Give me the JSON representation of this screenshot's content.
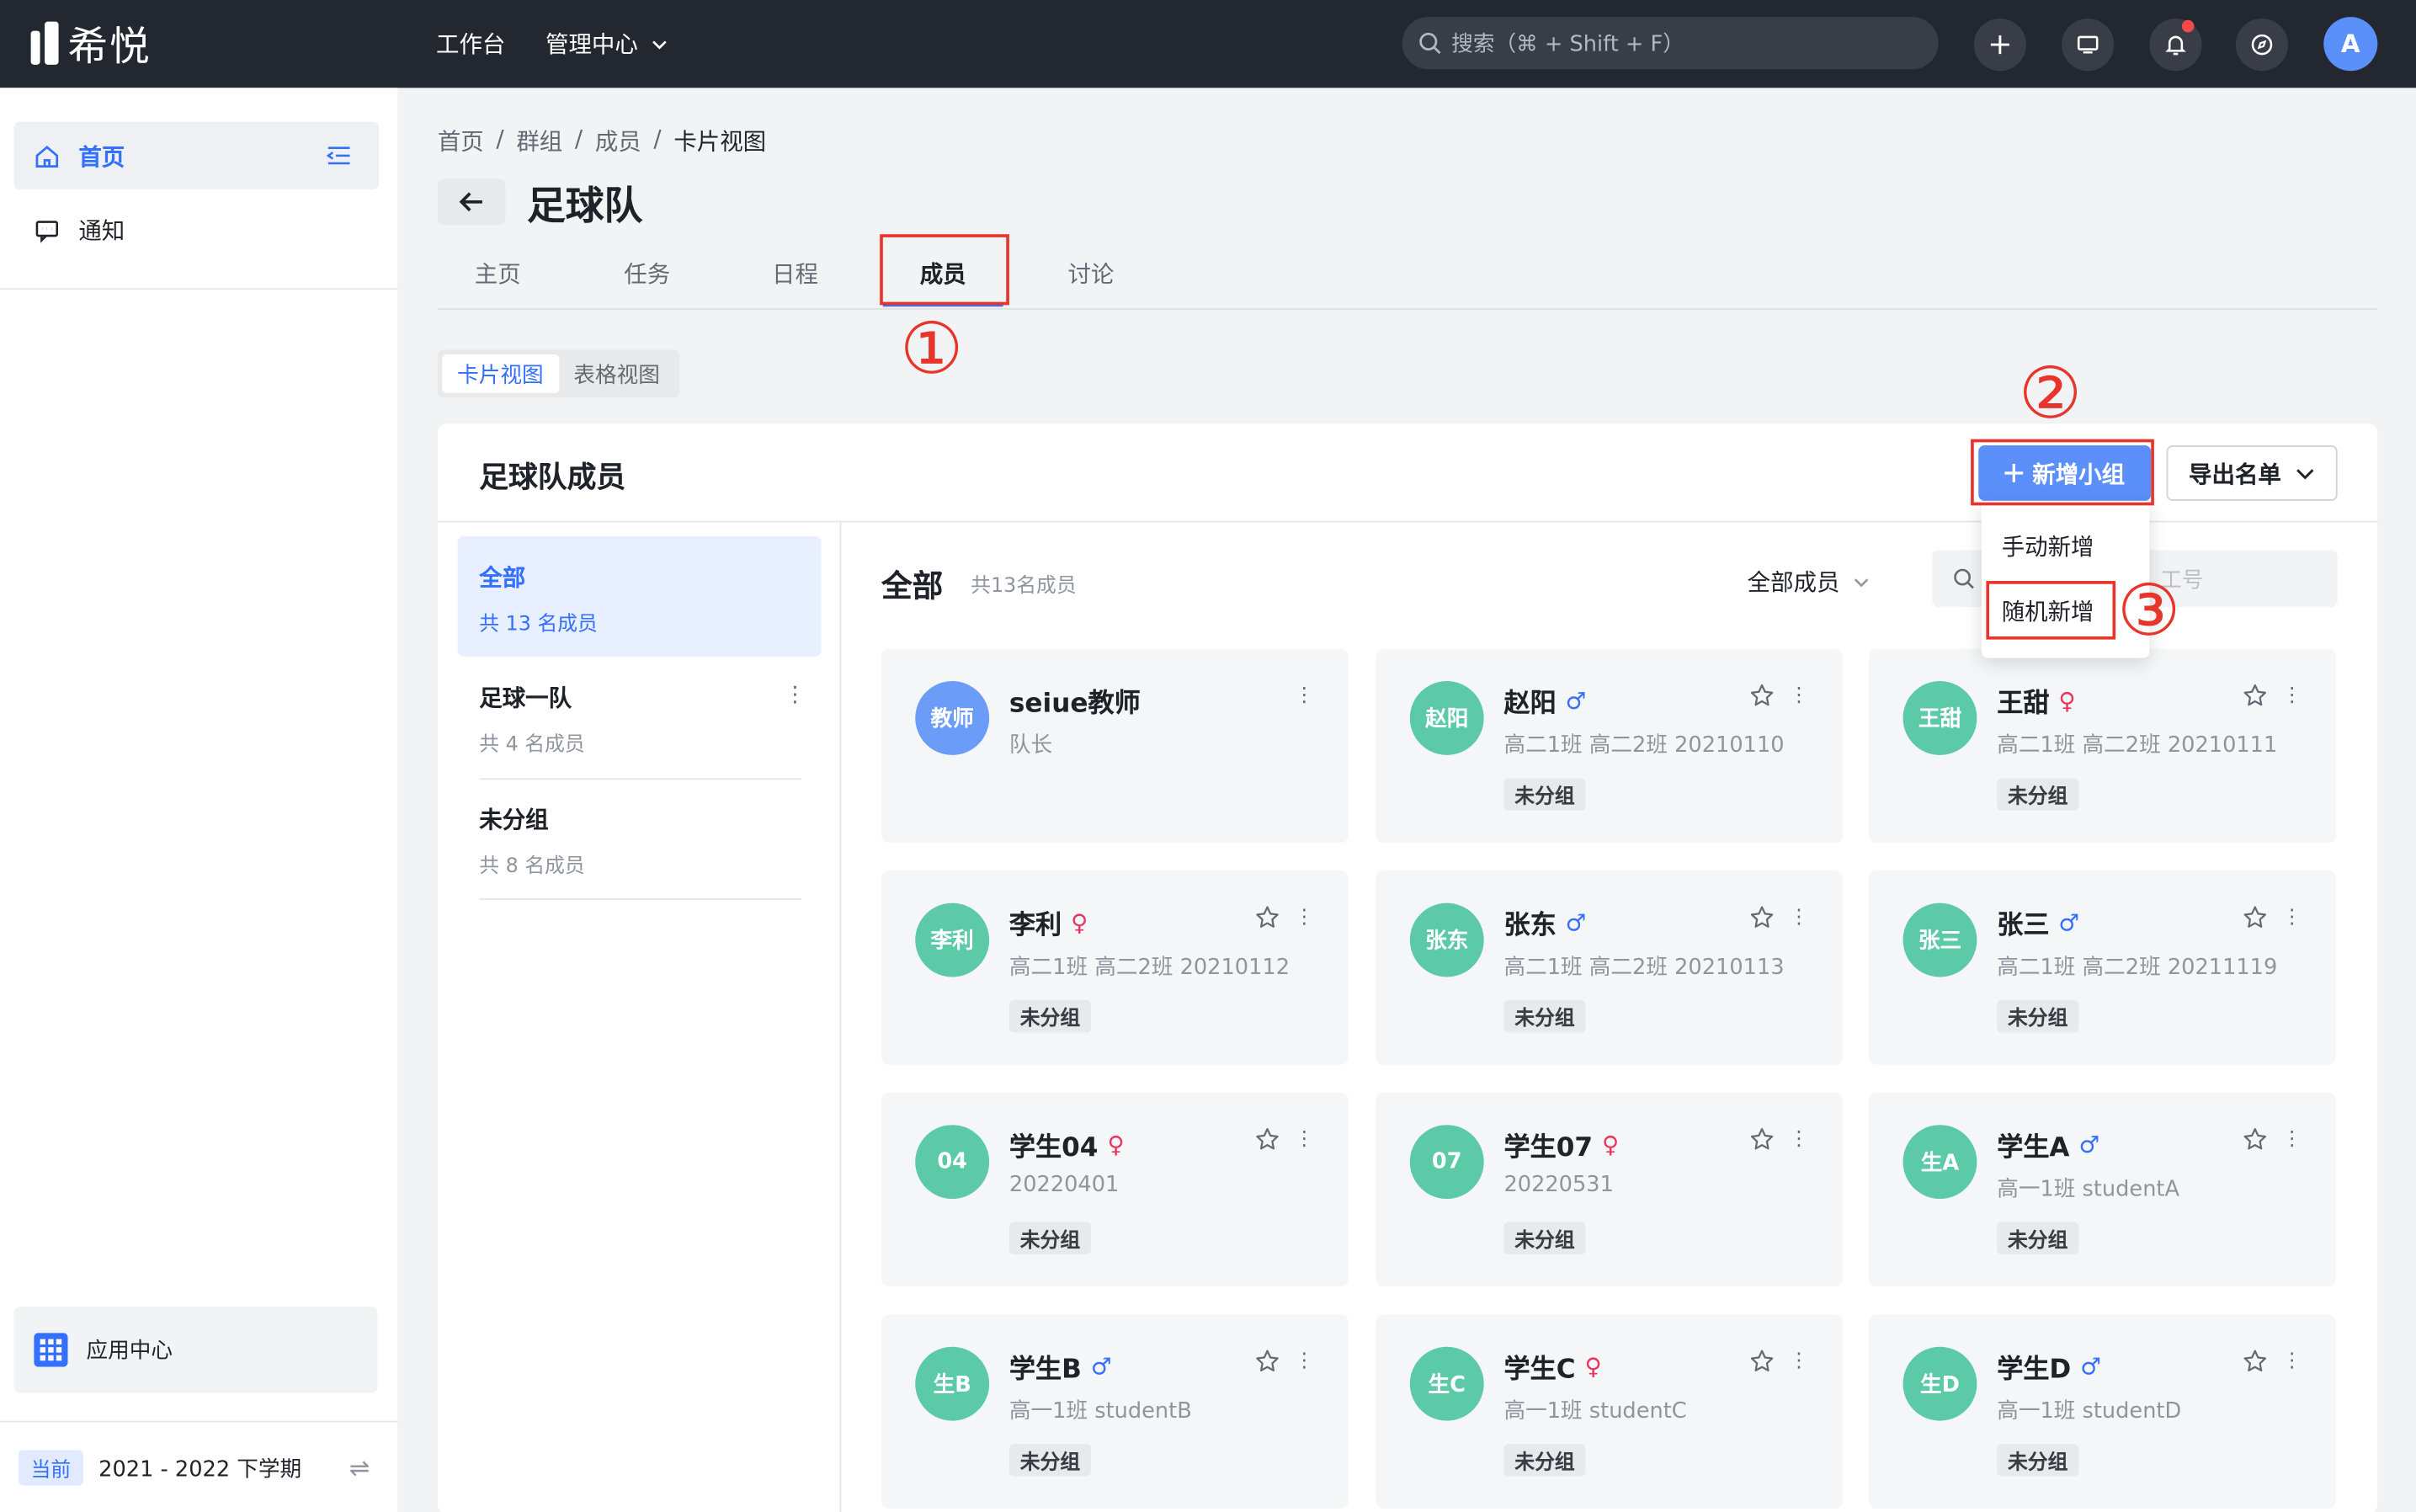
{
  "topbar": {
    "logo_text": "希悦",
    "nav": [
      "工作台",
      "管理中心"
    ],
    "search_placeholder": "搜索（⌘ + Shift + F）",
    "avatar_initial": "A"
  },
  "sidebar": {
    "items": [
      {
        "label": "首页",
        "icon": "home-icon",
        "active": true
      },
      {
        "label": "通知",
        "icon": "message-icon",
        "active": false
      }
    ],
    "app_center": "应用中心",
    "term_badge": "当前",
    "term": "2021 - 2022 下学期"
  },
  "breadcrumb": [
    "首页",
    "群组",
    "成员",
    "卡片视图"
  ],
  "page_title": "足球队",
  "tabs": [
    "主页",
    "任务",
    "日程",
    "成员",
    "讨论"
  ],
  "active_tab": "成员",
  "view_toggle": [
    "卡片视图",
    "表格视图"
  ],
  "annotations": [
    "①",
    "②",
    "③"
  ],
  "panel": {
    "title": "足球队成员",
    "add_group_button": "新增小组",
    "export_button": "导出名单",
    "add_menu": [
      "手动新增",
      "随机新增"
    ]
  },
  "groups": [
    {
      "name": "全部",
      "count": "共 13 名成员",
      "active": true
    },
    {
      "name": "足球一队",
      "count": "共 4 名成员",
      "active": false
    },
    {
      "name": "未分组",
      "count": "共 8 名成员",
      "active": false
    }
  ],
  "list": {
    "title": "全部",
    "count": "共13名成员",
    "filter": "全部成员",
    "search_placeholder_visible": "工号"
  },
  "colors": {
    "accent": "#3370ff",
    "primary_button": "#5b8ff9",
    "avatar_green": "#5cc9a7",
    "avatar_blue": "#6b9cf7",
    "annotation_red": "#e8352c"
  },
  "members": [
    {
      "avatar": "教师",
      "name": "seiue教师",
      "gender": "",
      "sub": "队长",
      "tag": "",
      "avatar_color": "#6b9cf7"
    },
    {
      "avatar": "赵阳",
      "name": "赵阳",
      "gender": "♂",
      "sub": "高二1班 高二2班 20210110",
      "tag": "未分组",
      "avatar_color": "#5cc9a7"
    },
    {
      "avatar": "王甜",
      "name": "王甜",
      "gender": "♀",
      "sub": "高二1班 高二2班 20210111",
      "tag": "未分组",
      "avatar_color": "#5cc9a7"
    },
    {
      "avatar": "李利",
      "name": "李利",
      "gender": "♀",
      "sub": "高二1班 高二2班 20210112",
      "tag": "未分组",
      "avatar_color": "#5cc9a7"
    },
    {
      "avatar": "张东",
      "name": "张东",
      "gender": "♂",
      "sub": "高二1班 高二2班 20210113",
      "tag": "未分组",
      "avatar_color": "#5cc9a7"
    },
    {
      "avatar": "张三",
      "name": "张三",
      "gender": "♂",
      "sub": "高二1班 高二2班 20211119",
      "tag": "未分组",
      "avatar_color": "#5cc9a7"
    },
    {
      "avatar": "04",
      "name": "学生04",
      "gender": "♀",
      "sub": "20220401",
      "tag": "未分组",
      "avatar_color": "#5cc9a7"
    },
    {
      "avatar": "07",
      "name": "学生07",
      "gender": "♀",
      "sub": "20220531",
      "tag": "未分组",
      "avatar_color": "#5cc9a7"
    },
    {
      "avatar": "生A",
      "name": "学生A",
      "gender": "♂",
      "sub": "高一1班 studentA",
      "tag": "未分组",
      "avatar_color": "#5cc9a7"
    },
    {
      "avatar": "生B",
      "name": "学生B",
      "gender": "♂",
      "sub": "高一1班 studentB",
      "tag": "未分组",
      "avatar_color": "#5cc9a7"
    },
    {
      "avatar": "生C",
      "name": "学生C",
      "gender": "♀",
      "sub": "高一1班 studentC",
      "tag": "未分组",
      "avatar_color": "#5cc9a7"
    },
    {
      "avatar": "生D",
      "name": "学生D",
      "gender": "♂",
      "sub": "高一1班 studentD",
      "tag": "未分组",
      "avatar_color": "#5cc9a7"
    }
  ]
}
